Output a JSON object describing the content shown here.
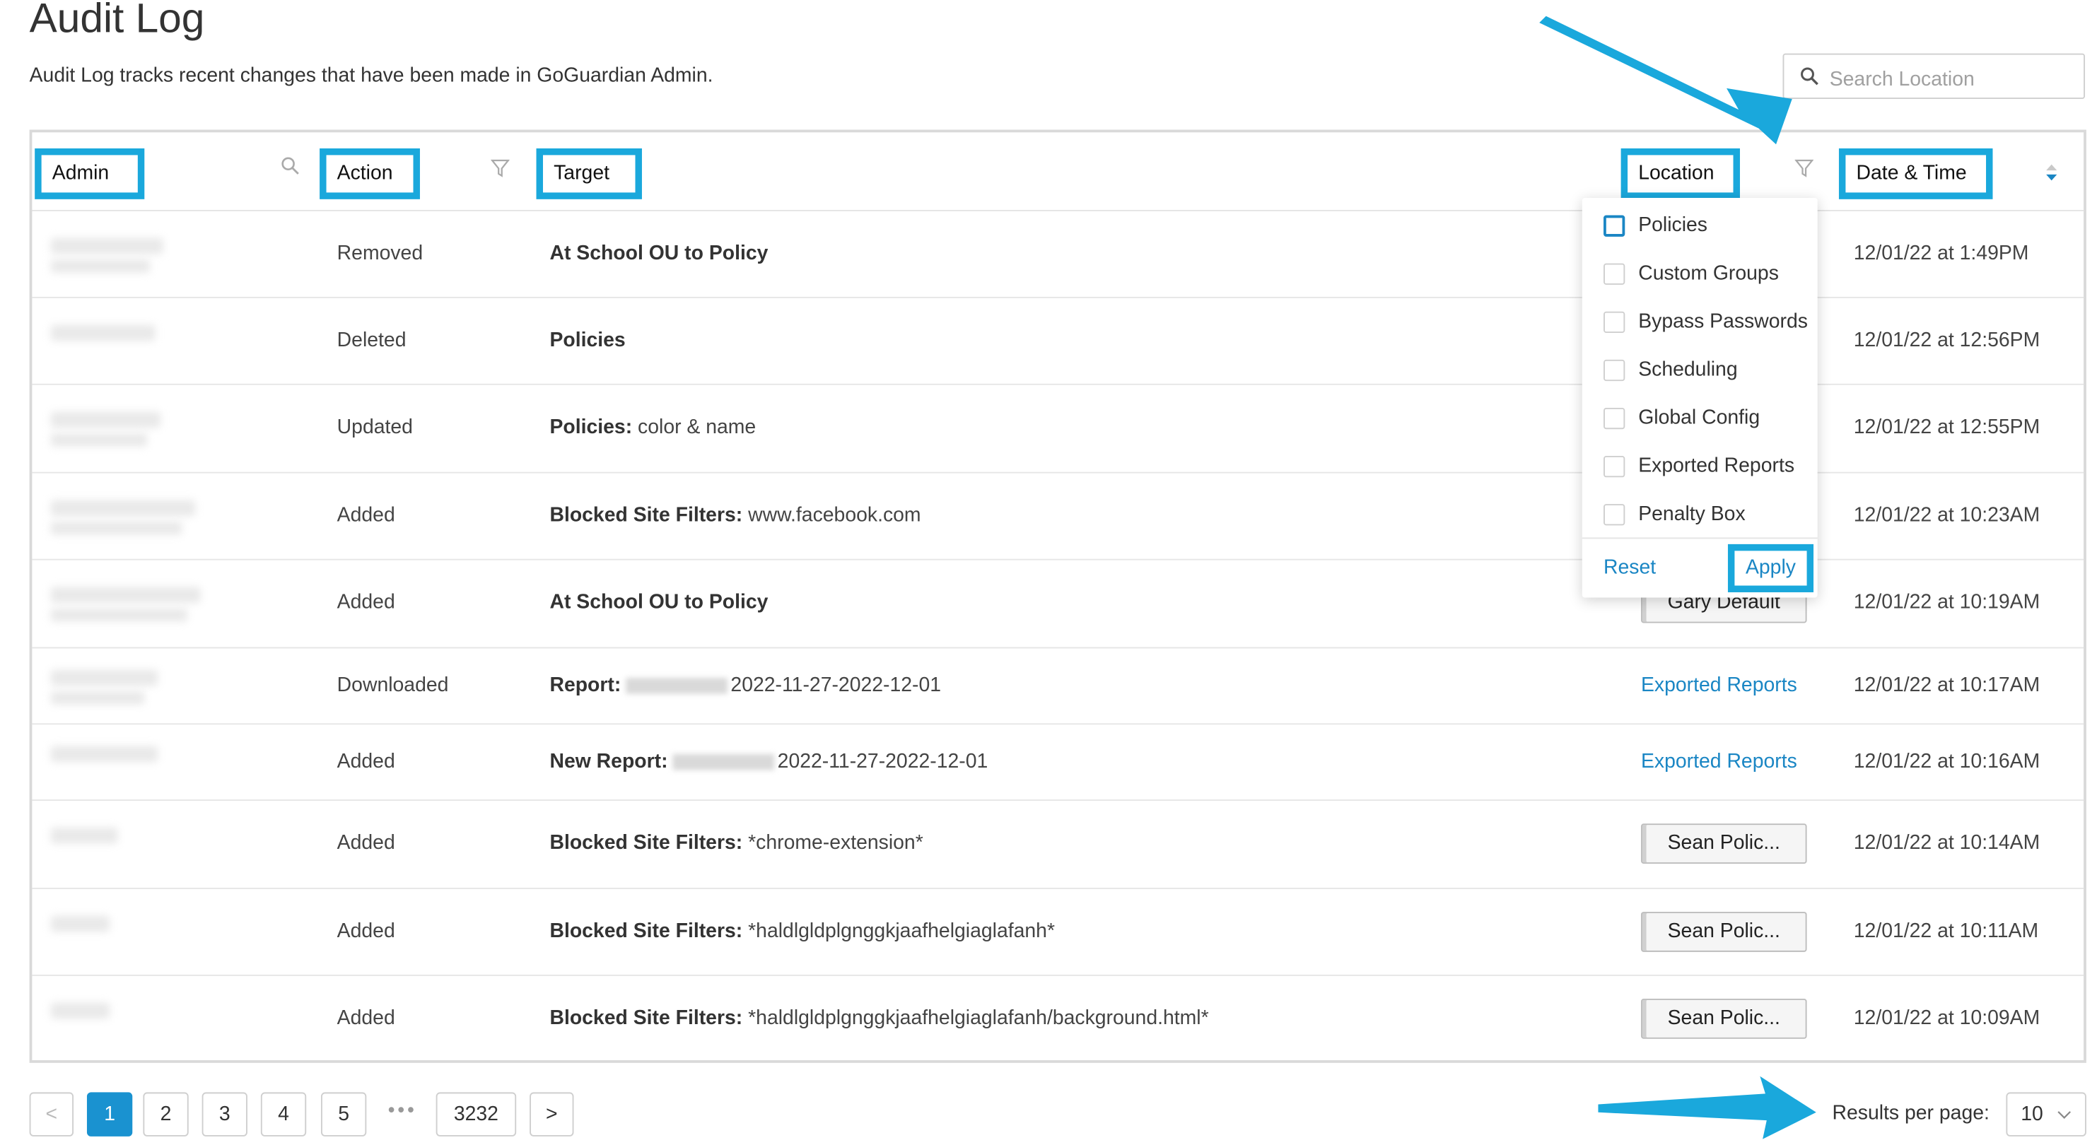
{
  "page": {
    "title": "Audit Log",
    "description": "Audit Log tracks recent changes that have been made in GoGuardian Admin."
  },
  "search": {
    "placeholder": "Search Location"
  },
  "columns": {
    "admin": "Admin",
    "action": "Action",
    "target": "Target",
    "location": "Location",
    "datetime": "Date & Time"
  },
  "rows": [
    {
      "action": "Removed",
      "target_bold": "At School OU to Policy",
      "target_rest": "",
      "location": "",
      "datetime": "12/01/22 at 1:49PM"
    },
    {
      "action": "Deleted",
      "target_bold": "Policies",
      "target_rest": "",
      "location": "",
      "datetime": "12/01/22 at 12:56PM"
    },
    {
      "action": "Updated",
      "target_bold": "Policies:",
      "target_rest": " color & name",
      "location": "",
      "datetime": "12/01/22 at 12:55PM"
    },
    {
      "action": "Added",
      "target_bold": "Blocked Site Filters:",
      "target_rest": " www.facebook.com",
      "location": "",
      "datetime": "12/01/22 at 10:23AM"
    },
    {
      "action": "Added",
      "target_bold": "At School OU to Policy",
      "target_rest": "",
      "location": "Gary Default",
      "datetime": "12/01/22 at 10:19AM"
    },
    {
      "action": "Downloaded",
      "target_bold": "Report:",
      "target_rest": "2022-11-27-2022-12-01",
      "location": "Exported Reports",
      "datetime": "12/01/22 at 10:17AM"
    },
    {
      "action": "Added",
      "target_bold": "New Report:",
      "target_rest": "2022-11-27-2022-12-01",
      "location": "Exported Reports",
      "datetime": "12/01/22 at 10:16AM"
    },
    {
      "action": "Added",
      "target_bold": "Blocked Site Filters:",
      "target_rest": " *chrome-extension*",
      "location": "Sean Polic...",
      "datetime": "12/01/22 at 10:14AM"
    },
    {
      "action": "Added",
      "target_bold": "Blocked Site Filters:",
      "target_rest": " *haldlgldplgnggkjaafhelgiaglafanh*",
      "location": "Sean Polic...",
      "datetime": "12/01/22 at 10:11AM"
    },
    {
      "action": "Added",
      "target_bold": "Blocked Site Filters:",
      "target_rest": " *haldlgldplgnggkjaafhelgiaglafanh/background.html*",
      "location": "Sean Polic...",
      "datetime": "12/01/22 at 10:09AM"
    }
  ],
  "location_filter": {
    "options": [
      "Policies",
      "Custom Groups",
      "Bypass Passwords",
      "Scheduling",
      "Global Config",
      "Exported Reports",
      "Penalty Box"
    ],
    "reset_label": "Reset",
    "apply_label": "Apply"
  },
  "pagination": {
    "prev": "<",
    "pages": [
      "1",
      "2",
      "3",
      "4",
      "5"
    ],
    "ellipsis": "•••",
    "last_page": "3232",
    "next": ">",
    "current": 1
  },
  "results_per_page": {
    "label": "Results per page:",
    "value": "10"
  },
  "colors": {
    "accent": "#1a92d0",
    "highlight": "#1aa8dc",
    "link": "#1a86c4"
  },
  "icons": [
    "search-icon",
    "filter-icon",
    "sort-icon",
    "chevron-down-icon",
    "arrow-annotation"
  ]
}
